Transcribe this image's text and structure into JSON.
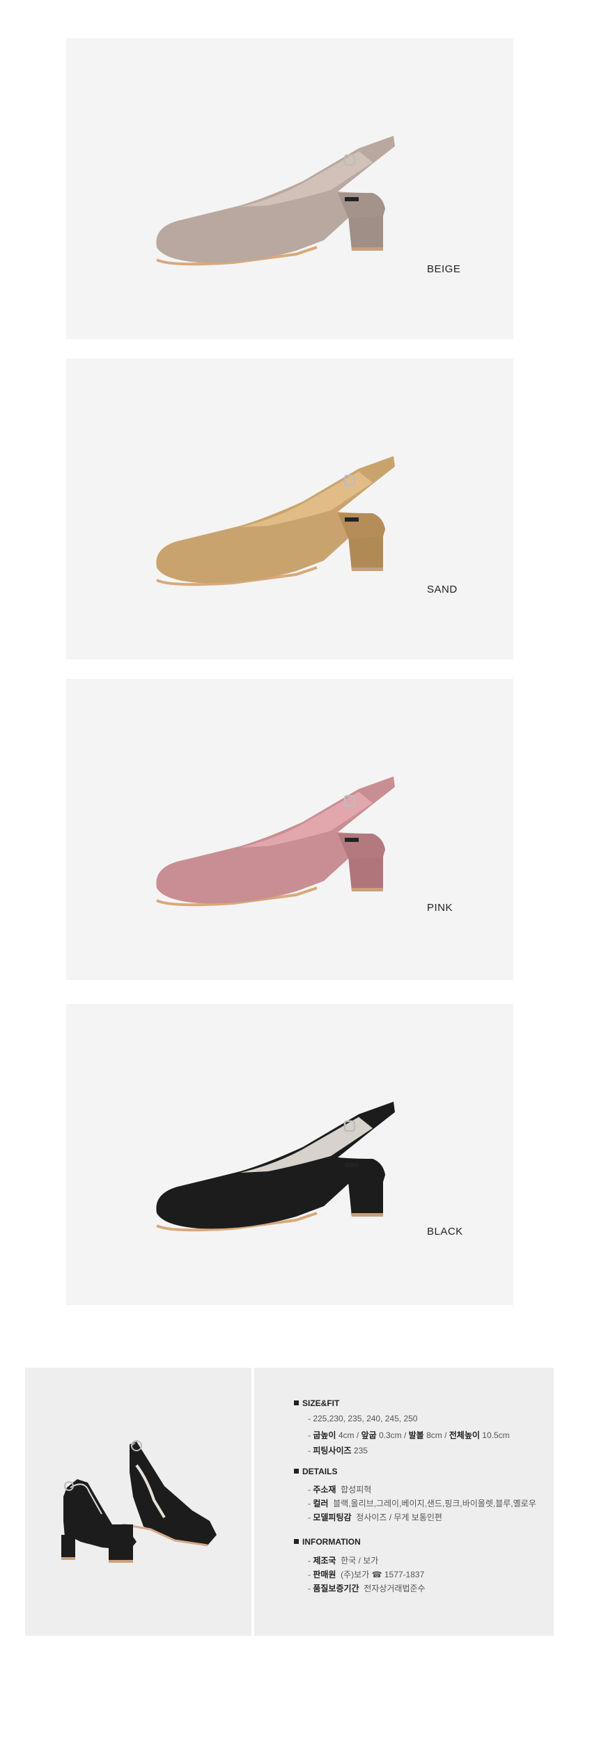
{
  "colors": {
    "beige": "#b9a89f",
    "sand": "#c9a36e",
    "pink": "#c98e93",
    "black": "#1c1c1c",
    "panel_bg": "#f4f4f4",
    "info_bg": "#eeeeee"
  },
  "products": [
    {
      "color_name": "BEIGE"
    },
    {
      "color_name": "SAND"
    },
    {
      "color_name": "PINK"
    },
    {
      "color_name": "BLACK"
    }
  ],
  "info": {
    "size_fit": {
      "title": "SIZE&FIT",
      "sizes": "- 225,230, 235, 240, 245, 250",
      "heel_label": "굽높이",
      "heel_value": "4cm",
      "front_label": "앞굽",
      "front_value": "0.3cm",
      "ball_label": "발볼",
      "ball_value": "8cm",
      "total_label": "전체높이",
      "total_value": "10.5cm",
      "fitting_label": "피팅사이즈",
      "fitting_value": "235"
    },
    "details": {
      "title": "DETAILS",
      "material_label": "주소재",
      "material_value": "합성피혁",
      "color_label": "컬러",
      "color_value": "블랙,올리브,그레이,베이지,샌드,핑크,바이올렛,블루,옐로우",
      "model_label": "모델피팅감",
      "model_value": "정사이즈 / 무게 보통인편"
    },
    "information": {
      "title": "INFORMATION",
      "origin_label": "제조국",
      "origin_value": "한국 / 보가",
      "seller_label": "판매원",
      "seller_value": "(주)보가 ☎ 1577-1837",
      "warranty_label": "품질보증기간",
      "warranty_value": "전자상거래법준수"
    }
  }
}
